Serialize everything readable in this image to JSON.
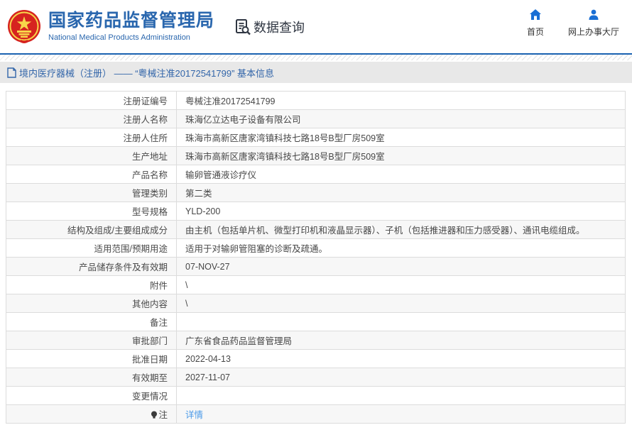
{
  "header": {
    "title_cn": "国家药品监督管理局",
    "title_en": "National Medical Products Administration",
    "data_query_label": "数据查询",
    "nav_home_label": "首页",
    "nav_hall_label": "网上办事大厅"
  },
  "breadcrumb": {
    "text": "境内医疗器械（注册） —— “粤械注准20172541799” 基本信息"
  },
  "colors": {
    "accent_blue": "#1b62b1",
    "title_blue": "#2a67ae",
    "breadcrumb_bg": "#e8e8e8",
    "link_blue": "#4a9ae8",
    "row_alt_bg": "#f7f7f7",
    "emblem_red": "#d6231f",
    "emblem_yellow": "#f7d64a"
  },
  "table": {
    "rows": [
      {
        "label": "注册证编号",
        "value": "粤械注准20172541799",
        "link": false,
        "note_icon": false
      },
      {
        "label": "注册人名称",
        "value": "珠海亿立达电子设备有限公司",
        "link": false,
        "note_icon": false
      },
      {
        "label": "注册人住所",
        "value": "珠海市高新区唐家湾镇科技七路18号B型厂房509室",
        "link": false,
        "note_icon": false
      },
      {
        "label": "生产地址",
        "value": "珠海市高新区唐家湾镇科技七路18号B型厂房509室",
        "link": false,
        "note_icon": false
      },
      {
        "label": "产品名称",
        "value": "输卵管通液诊疗仪",
        "link": false,
        "note_icon": false
      },
      {
        "label": "管理类别",
        "value": "第二类",
        "link": false,
        "note_icon": false
      },
      {
        "label": "型号规格",
        "value": "YLD-200",
        "link": false,
        "note_icon": false
      },
      {
        "label": "结构及组成/主要组成成分",
        "value": "由主机（包括单片机、微型打印机和液晶显示器）、子机（包括推进器和压力感受器）、通讯电缆组成。",
        "link": false,
        "note_icon": false
      },
      {
        "label": "适用范围/预期用途",
        "value": "适用于对输卵管阻塞的诊断及疏通。",
        "link": false,
        "note_icon": false
      },
      {
        "label": "产品储存条件及有效期",
        "value": "07-NOV-27",
        "link": false,
        "note_icon": false
      },
      {
        "label": "附件",
        "value": "\\",
        "link": false,
        "note_icon": false
      },
      {
        "label": "其他内容",
        "value": "\\",
        "link": false,
        "note_icon": false
      },
      {
        "label": "备注",
        "value": "",
        "link": false,
        "note_icon": false
      },
      {
        "label": "审批部门",
        "value": "广东省食品药品监督管理局",
        "link": false,
        "note_icon": false
      },
      {
        "label": "批准日期",
        "value": "2022-04-13",
        "link": false,
        "note_icon": false
      },
      {
        "label": "有效期至",
        "value": "2027-11-07",
        "link": false,
        "note_icon": false
      },
      {
        "label": "变更情况",
        "value": "",
        "link": false,
        "note_icon": false
      },
      {
        "label": "注",
        "value": "详情",
        "link": true,
        "note_icon": true
      }
    ]
  }
}
